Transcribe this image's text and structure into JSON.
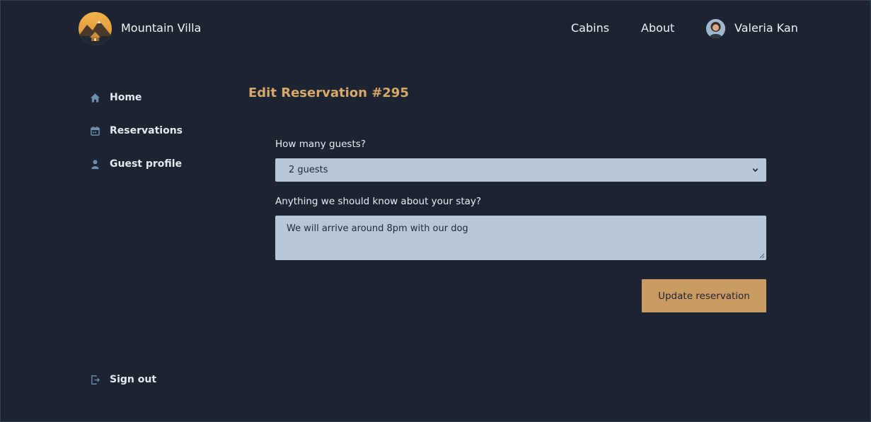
{
  "header": {
    "brand": "Mountain Villa",
    "nav": {
      "cabins": "Cabins",
      "about": "About",
      "user_name": "Valeria Kan"
    }
  },
  "sidebar": {
    "items": [
      {
        "label": "Home",
        "icon": "home-icon"
      },
      {
        "label": "Reservations",
        "icon": "calendar-icon"
      },
      {
        "label": "Guest profile",
        "icon": "user-icon"
      }
    ],
    "sign_out": {
      "label": "Sign out",
      "icon": "sign-out-icon"
    }
  },
  "main": {
    "title": "Edit Reservation #295",
    "guests": {
      "label": "How many guests?",
      "value": "2 guests"
    },
    "notes": {
      "label": "Anything we should know about your stay?",
      "value": "We will arrive around 8pm with our dog"
    },
    "submit_label": "Update reservation"
  },
  "colors": {
    "background": "#1b2430",
    "accent": "#c99a62",
    "title": "#d7a86a",
    "field": "#b6c7d9",
    "icon": "#6d8eb0"
  }
}
